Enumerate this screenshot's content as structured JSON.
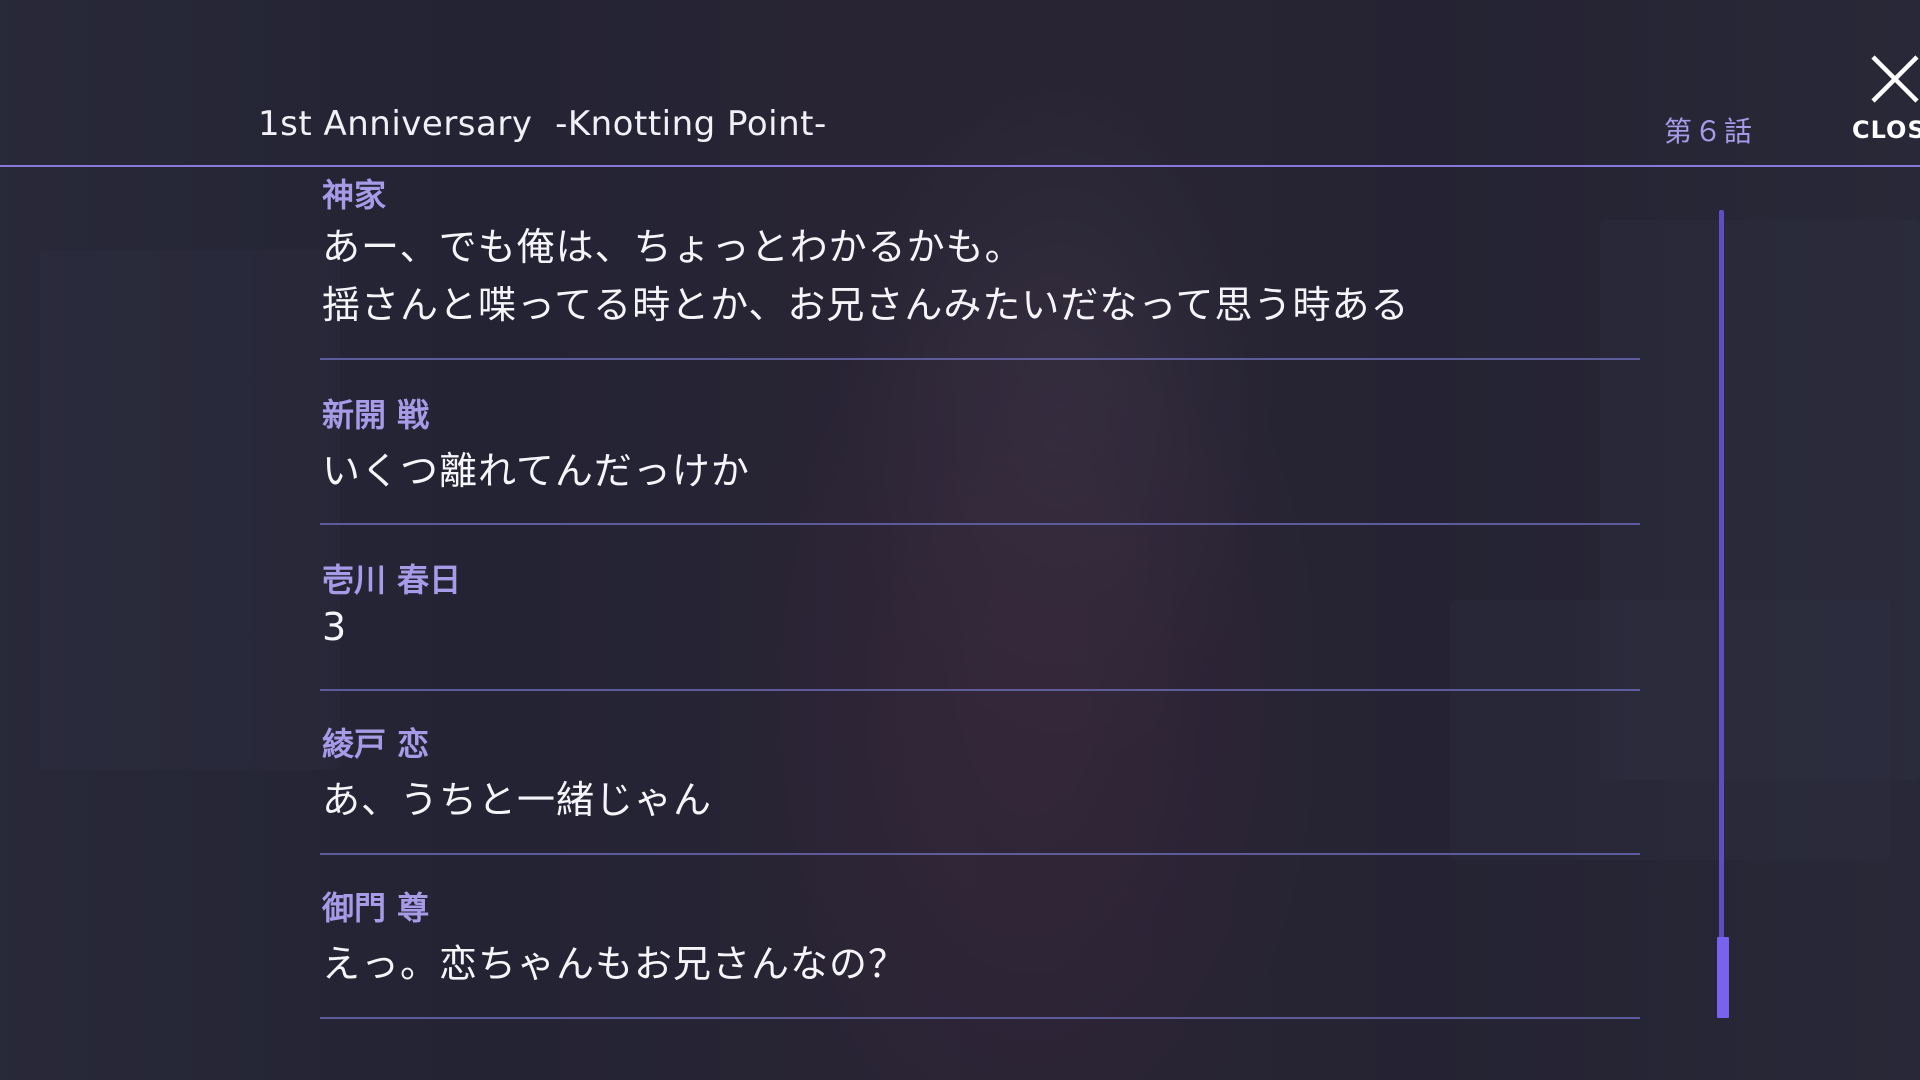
{
  "header": {
    "title": "1st Anniversary  -Knotting Point-",
    "episode": "第６話",
    "close_label": "CLOSE"
  },
  "log": [
    {
      "speaker": "神家",
      "lines": [
        "あー、でも俺は、ちょっとわかるかも。",
        "揺さんと喋ってる時とか、お兄さんみたいだなって思う時ある"
      ]
    },
    {
      "speaker": "新開 戦",
      "lines": [
        "いくつ離れてんだっけか"
      ]
    },
    {
      "speaker": "壱川 春日",
      "lines": [
        "3"
      ]
    },
    {
      "speaker": "綾戸 恋",
      "lines": [
        "あ、うちと一緒じゃん"
      ]
    },
    {
      "speaker": "御門 尊",
      "lines": [
        "えっ。恋ちゃんもお兄さんなの？"
      ]
    }
  ],
  "scrollbar": {
    "position": 1.0
  },
  "colors": {
    "accent": "#a79be8",
    "header_line": "#8a78d8",
    "divider": "#5d5a9e",
    "scroll_thumb": "#7a62f0"
  }
}
